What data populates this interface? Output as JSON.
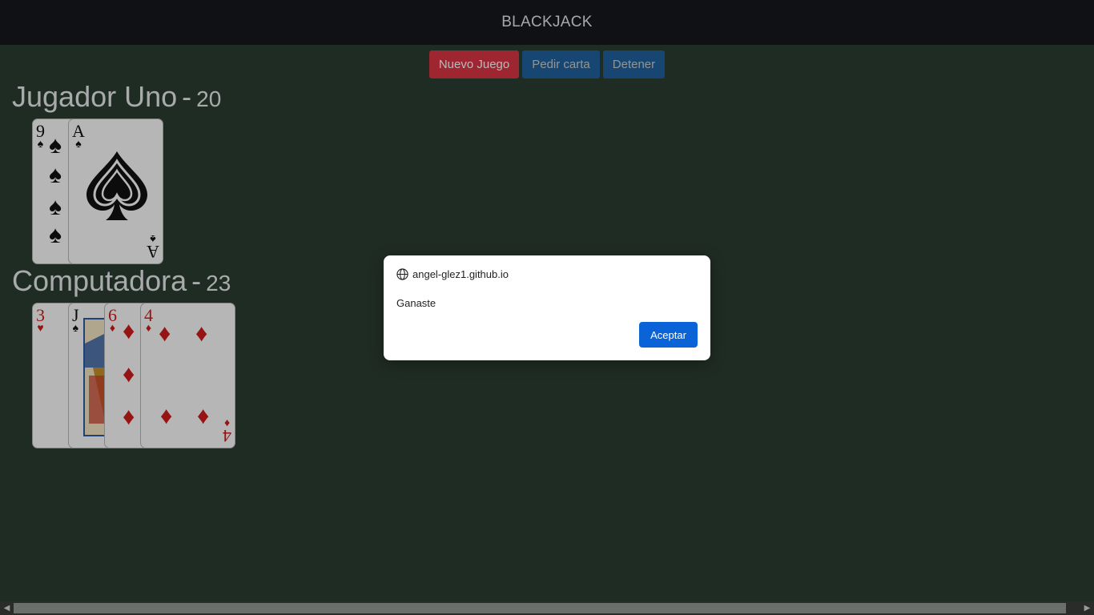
{
  "header": {
    "title": "BLACKJACK"
  },
  "controls": {
    "new_game": "Nuevo Juego",
    "ask_card": "Pedir carta",
    "stop": "Detener"
  },
  "player": {
    "name": "Jugador Uno",
    "separator": "-",
    "score": "20",
    "cards": [
      {
        "rank": "9",
        "suit": "♠",
        "color": "black"
      },
      {
        "rank": "A",
        "suit": "♠",
        "color": "black"
      }
    ]
  },
  "computer": {
    "name": "Computadora",
    "separator": "-",
    "score": "23",
    "cards": [
      {
        "rank": "3",
        "suit": "♥",
        "color": "red"
      },
      {
        "rank": "J",
        "suit": "♠",
        "color": "black"
      },
      {
        "rank": "6",
        "suit": "♦",
        "color": "red"
      },
      {
        "rank": "4",
        "suit": "♦",
        "color": "red"
      }
    ]
  },
  "dialog": {
    "origin": "angel-glez1.github.io",
    "message": "Ganaste",
    "ok_label": "Aceptar"
  },
  "colors": {
    "table_green": "#2b3d31",
    "danger": "#dc3545",
    "primary": "#1f6fc4",
    "dialog_button": "#0b63d8"
  }
}
